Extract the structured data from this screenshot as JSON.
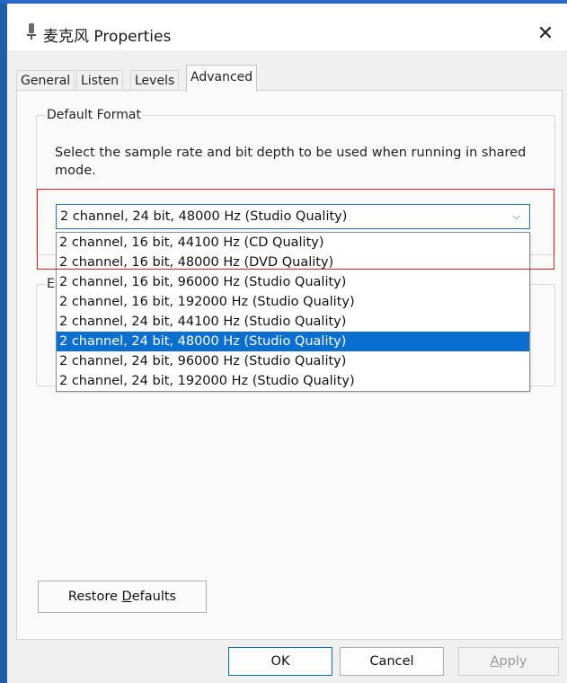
{
  "window": {
    "title": "麦克风 Properties",
    "close_glyph": "✕",
    "icon": "microphone-icon"
  },
  "tabs": [
    {
      "label": "General",
      "active": false
    },
    {
      "label": "Listen",
      "active": false
    },
    {
      "label": "Levels",
      "active": false
    },
    {
      "label": "Advanced",
      "active": true
    }
  ],
  "default_format": {
    "legend": "Default Format",
    "description": "Select the sample rate and bit depth to be used when running in shared mode.",
    "selected_value": "2 channel, 24 bit, 48000 Hz (Studio Quality)",
    "chevron": "⌵",
    "options": [
      {
        "label": "2 channel, 16 bit, 44100 Hz (CD Quality)",
        "selected": false
      },
      {
        "label": "2 channel, 16 bit, 48000 Hz (DVD Quality)",
        "selected": false
      },
      {
        "label": "2 channel, 16 bit, 96000 Hz (Studio Quality)",
        "selected": false
      },
      {
        "label": "2 channel, 16 bit, 192000 Hz (Studio Quality)",
        "selected": false
      },
      {
        "label": "2 channel, 24 bit, 44100 Hz (Studio Quality)",
        "selected": false
      },
      {
        "label": "2 channel, 24 bit, 48000 Hz (Studio Quality)",
        "selected": true
      },
      {
        "label": "2 channel, 24 bit, 96000 Hz (Studio Quality)",
        "selected": false
      },
      {
        "label": "2 channel, 24 bit, 192000 Hz (Studio Quality)",
        "selected": false
      }
    ]
  },
  "exclusive_group": {
    "legend_visible": "Ex"
  },
  "restore_defaults": {
    "prefix": "Restore ",
    "mnemonic": "D",
    "suffix": "efaults"
  },
  "buttons": {
    "ok": "OK",
    "cancel": "Cancel",
    "apply_mnemonic": "A",
    "apply_rest": "pply"
  },
  "colors": {
    "accent": "#0a6fcf",
    "highlight_border": "#e02020"
  }
}
